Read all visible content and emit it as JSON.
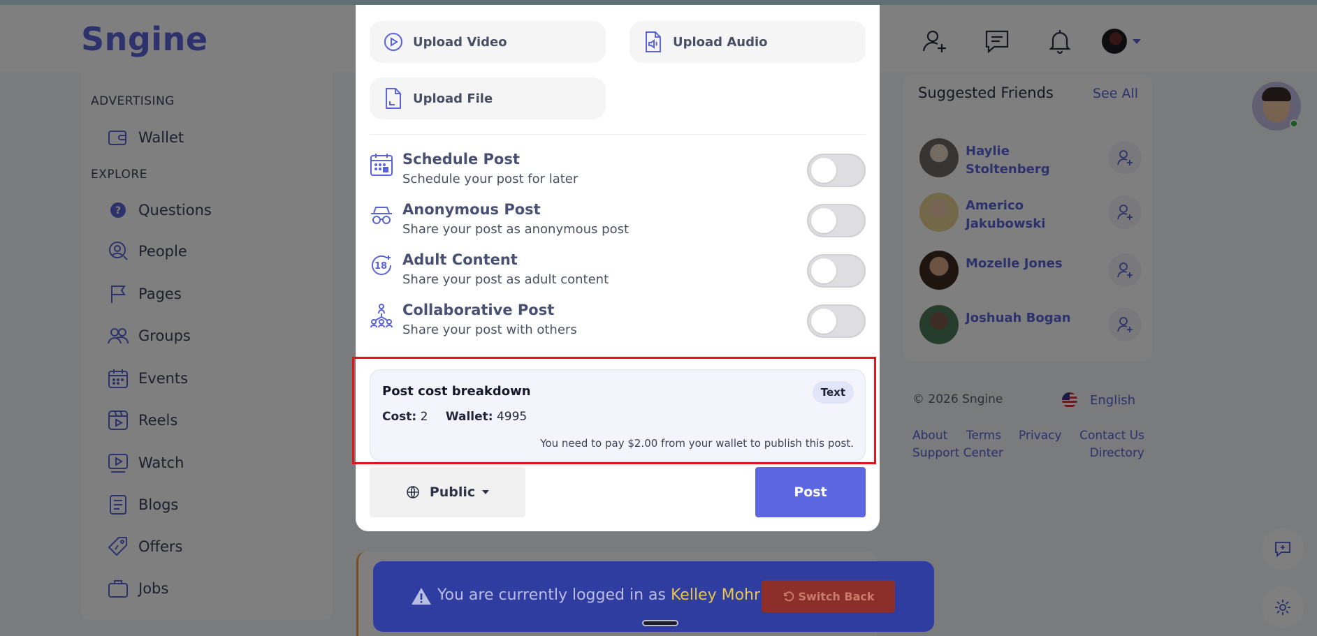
{
  "app": {
    "brand": "Sngine"
  },
  "header": {
    "icons": [
      "add-friend-icon",
      "messages-icon",
      "notifications-icon"
    ],
    "avatar": "user-avatar"
  },
  "sidebar": {
    "sections": [
      {
        "label": "ADVERTISING",
        "items": [
          {
            "label": "Wallet",
            "icon": "wallet-icon"
          }
        ]
      },
      {
        "label": "EXPLORE",
        "items": [
          {
            "label": "Questions",
            "icon": "question-icon"
          },
          {
            "label": "People",
            "icon": "people-icon"
          },
          {
            "label": "Pages",
            "icon": "flag-icon"
          },
          {
            "label": "Groups",
            "icon": "groups-icon"
          },
          {
            "label": "Events",
            "icon": "calendar-icon"
          },
          {
            "label": "Reels",
            "icon": "reels-icon"
          },
          {
            "label": "Watch",
            "icon": "watch-icon"
          },
          {
            "label": "Blogs",
            "icon": "blog-icon"
          },
          {
            "label": "Offers",
            "icon": "offers-icon"
          },
          {
            "label": "Jobs",
            "icon": "briefcase-icon"
          }
        ]
      }
    ]
  },
  "suggested": {
    "title": "Suggested Friends",
    "see_all": "See All",
    "friends": [
      {
        "name": "Haylie Stoltenberg"
      },
      {
        "name": "Americo Jakubowski"
      },
      {
        "name": "Mozelle Jones"
      },
      {
        "name": "Joshuah Bogan"
      }
    ]
  },
  "footer": {
    "copyright": "© 2026 Sngine",
    "language": "English",
    "links": [
      "About",
      "Terms",
      "Privacy",
      "Contact Us",
      "Support Center",
      "Directory"
    ]
  },
  "modal": {
    "uploads": [
      {
        "label": "Upload Video",
        "icon": "video-icon"
      },
      {
        "label": "Upload Audio",
        "icon": "audio-file-icon"
      },
      {
        "label": "Upload File",
        "icon": "file-icon"
      }
    ],
    "options": [
      {
        "title": "Schedule Post",
        "subtitle": "Schedule your post for later",
        "icon": "schedule-icon",
        "enabled": false
      },
      {
        "title": "Anonymous Post",
        "subtitle": "Share your post as anonymous post",
        "icon": "anonymous-icon",
        "enabled": false
      },
      {
        "title": "Adult Content",
        "subtitle": "Share your post as adult content",
        "icon": "adult-18-icon",
        "enabled": false
      },
      {
        "title": "Collaborative Post",
        "subtitle": "Share your post with others",
        "icon": "collaborate-icon",
        "enabled": false
      }
    ],
    "cost": {
      "title": "Post cost breakdown",
      "tag": "Text",
      "cost_label": "Cost:",
      "cost_value": "2",
      "wallet_label": "Wallet:",
      "wallet_value": "4995",
      "note": "You need to pay $2.00 from your wallet to publish this post."
    },
    "privacy": {
      "label": "Public",
      "icon": "globe-icon"
    },
    "post_label": "Post"
  },
  "banner": {
    "message": "You are currently logged in as",
    "user": "Kelley Mohr",
    "switch_back": "Switch Back"
  },
  "colors": {
    "accent": "#5b66e0",
    "highlight": "#e1141b",
    "banner": "#2f3ca0"
  }
}
